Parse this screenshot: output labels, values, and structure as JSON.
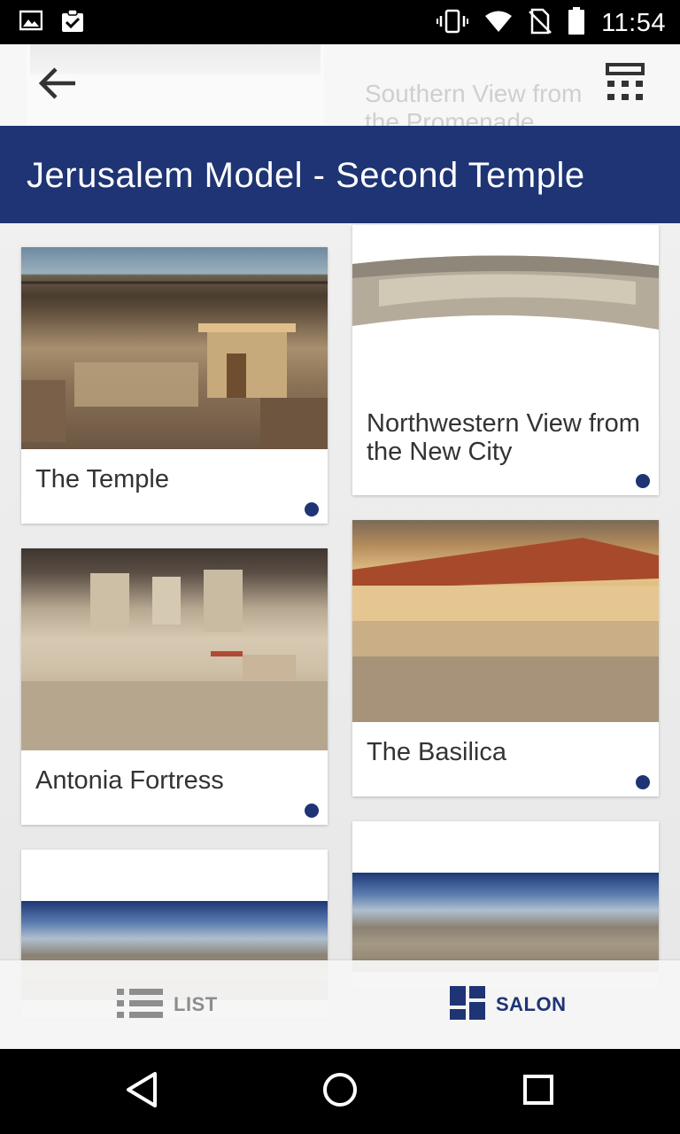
{
  "status_bar": {
    "time": "11:54",
    "left_icons": [
      "image-icon",
      "clipboard-check-icon"
    ],
    "right_icons": [
      "vibrate-icon",
      "wifi-icon",
      "no-sim-icon",
      "battery-icon"
    ]
  },
  "app_bar": {
    "back_icon": "arrow-left-icon",
    "layout_icon": "grid-layout-icon",
    "ghost_title": "Southern View from the Promenade"
  },
  "header": {
    "title": "Jerusalem Model - Second Temple"
  },
  "cards": [
    {
      "title": "The Temple",
      "image_icon": "temple-photo"
    },
    {
      "title": "Northwestern View from the New City",
      "image_icon": "panorama-photo"
    },
    {
      "title": "Antonia Fortress",
      "image_icon": "fortress-photo"
    },
    {
      "title": "The Basilica",
      "image_icon": "basilica-photo"
    }
  ],
  "bottom_tabs": {
    "list_label": "LIST",
    "salon_label": "SALON",
    "active": "SALON"
  },
  "colors": {
    "brand": "#1e3474",
    "inactive": "#8d8d8d"
  },
  "nav_bar": {
    "icons": [
      "back-triangle-icon",
      "home-circle-icon",
      "recents-square-icon"
    ]
  }
}
